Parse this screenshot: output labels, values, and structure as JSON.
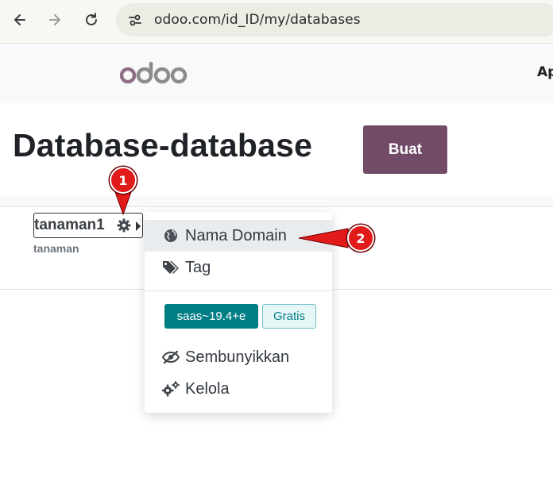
{
  "browser": {
    "url": "odoo.com/id_ID/my/databases",
    "icons": [
      "back-arrow-icon",
      "forward-arrow-icon",
      "reload-icon",
      "site-info-icon"
    ]
  },
  "header": {
    "logo_text": "odoo",
    "nav_partial": "Ap"
  },
  "page": {
    "title": "Database-database",
    "create_button": "Buat"
  },
  "database": {
    "name": "tanaman1",
    "subdomain": "tanaman"
  },
  "dropdown": {
    "items": [
      {
        "label": "Nama Domain",
        "icon": "globe-icon",
        "active": true
      },
      {
        "label": "Tag",
        "icon": "tags-icon",
        "active": false
      }
    ],
    "version_badge": "saas~19.4+e",
    "plan_badge": "Gratis",
    "actions": [
      {
        "label": "Sembunyikkan",
        "icon": "eye-slash-icon"
      },
      {
        "label": "Kelola",
        "icon": "cogs-icon"
      }
    ]
  },
  "callouts": [
    "1",
    "2"
  ],
  "colors": {
    "brand": "#714b67",
    "teal": "#017e84",
    "callout_red": "#e11a1a"
  }
}
